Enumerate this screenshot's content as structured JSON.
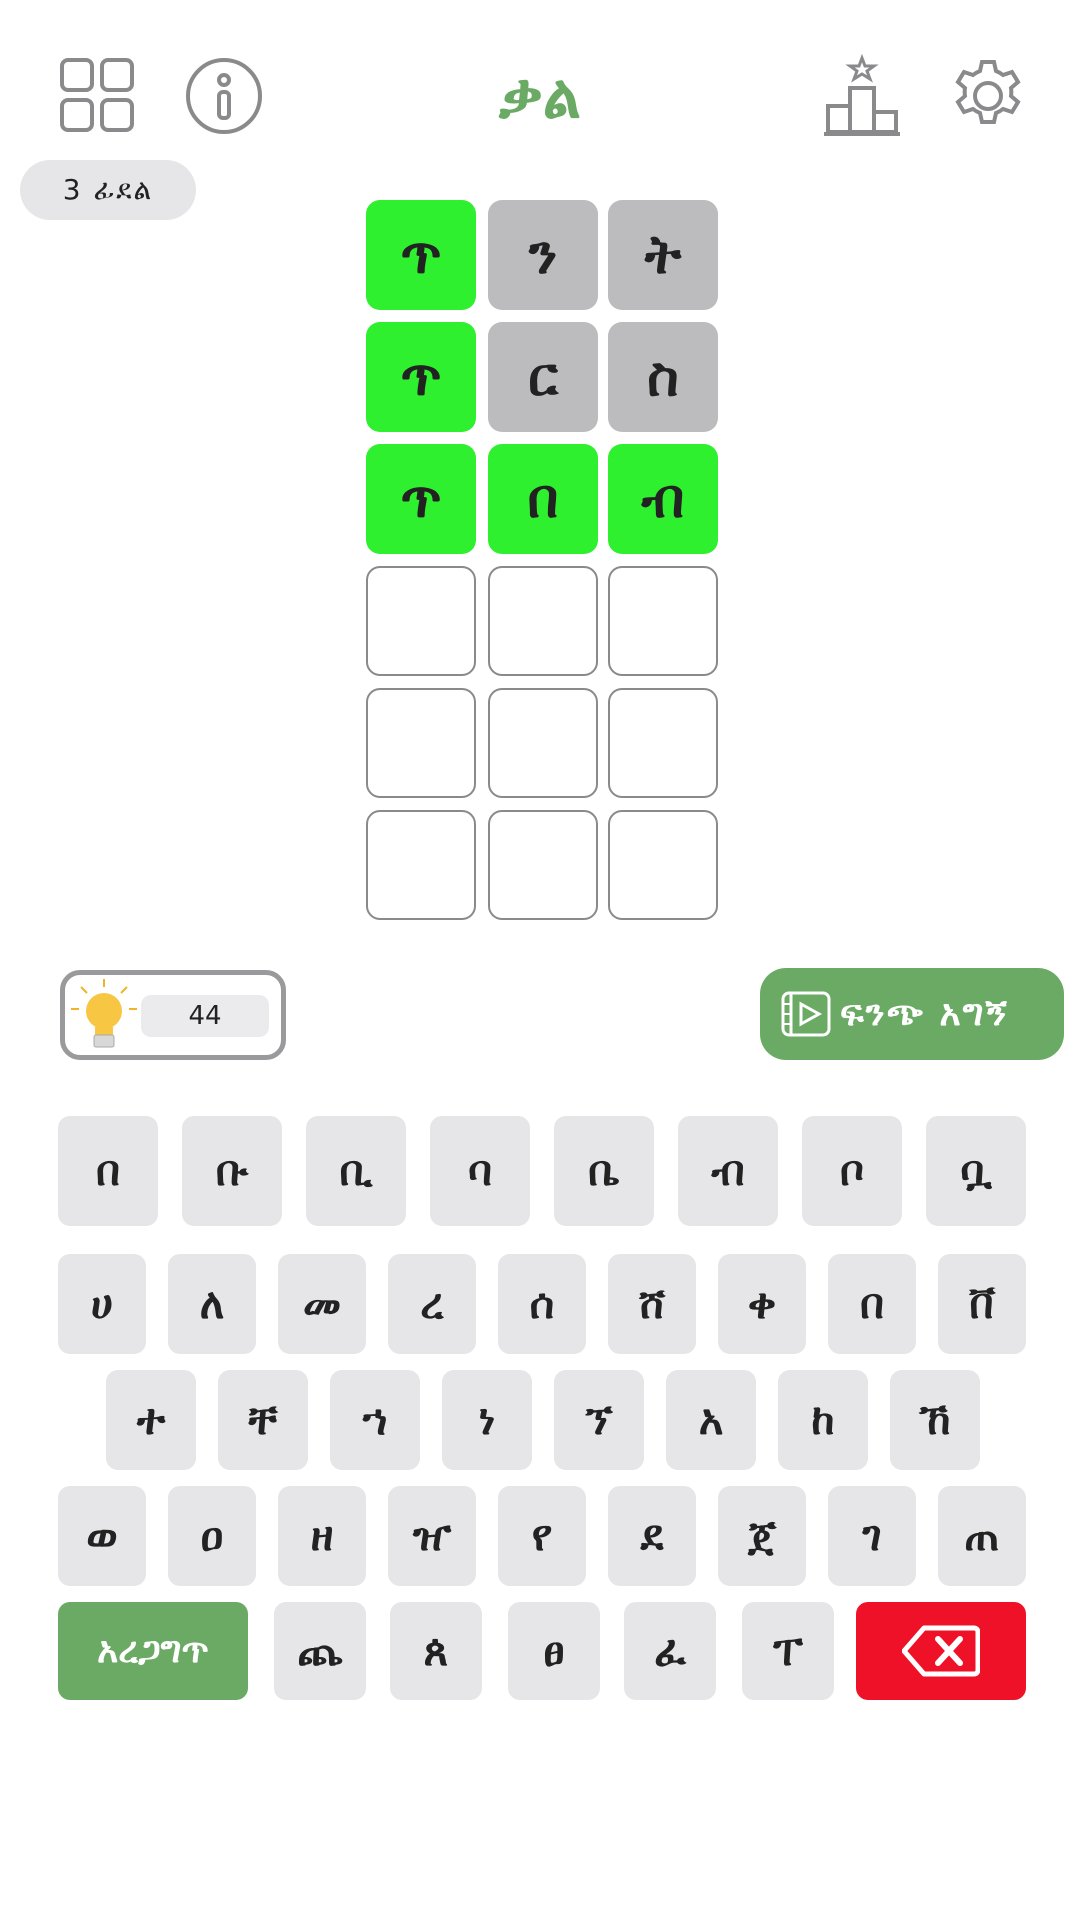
{
  "header": {
    "title": "ቃል",
    "menu_icon": "grid-icon",
    "info_icon": "info-icon",
    "stats_icon": "podium-icon",
    "settings_icon": "gear-icon"
  },
  "badge": {
    "label": "3 ፊደል"
  },
  "board": {
    "rows": [
      [
        {
          "letter": "ጥ",
          "state": "green"
        },
        {
          "letter": "ን",
          "state": "gray"
        },
        {
          "letter": "ት",
          "state": "gray"
        }
      ],
      [
        {
          "letter": "ጥ",
          "state": "green"
        },
        {
          "letter": "ር",
          "state": "gray"
        },
        {
          "letter": "ስ",
          "state": "gray"
        }
      ],
      [
        {
          "letter": "ጥ",
          "state": "green"
        },
        {
          "letter": "በ",
          "state": "green"
        },
        {
          "letter": "ብ",
          "state": "green"
        }
      ],
      [
        {
          "letter": "",
          "state": "empty"
        },
        {
          "letter": "",
          "state": "empty"
        },
        {
          "letter": "",
          "state": "empty"
        }
      ],
      [
        {
          "letter": "",
          "state": "empty"
        },
        {
          "letter": "",
          "state": "empty"
        },
        {
          "letter": "",
          "state": "empty"
        }
      ],
      [
        {
          "letter": "",
          "state": "empty"
        },
        {
          "letter": "",
          "state": "empty"
        },
        {
          "letter": "",
          "state": "empty"
        }
      ]
    ]
  },
  "hints": {
    "count": "44",
    "icon": "lightbulb-icon"
  },
  "reveal": {
    "label": "ፍንጭ አግኝ",
    "icon": "video-icon"
  },
  "keyboard": {
    "row1": [
      "በ",
      "ቡ",
      "ቢ",
      "ባ",
      "ቤ",
      "ብ",
      "ቦ",
      "ቧ"
    ],
    "row2": [
      "ሀ",
      "ለ",
      "መ",
      "ረ",
      "ሰ",
      "ሸ",
      "ቀ",
      "በ",
      "ቨ"
    ],
    "row3": [
      "ተ",
      "ቸ",
      "ኀ",
      "ነ",
      "ኘ",
      "አ",
      "ከ",
      "ኸ"
    ],
    "row4": [
      "ወ",
      "ዐ",
      "ዘ",
      "ዠ",
      "የ",
      "ደ",
      "ጀ",
      "ገ",
      "ጠ"
    ],
    "row5": [
      "ጨ",
      "ጰ",
      "ፀ",
      "ፈ",
      "ፐ"
    ],
    "check_label": "አረጋግጥ",
    "delete_icon": "backspace-icon"
  },
  "colors": {
    "accent": "#6aaa64",
    "correct": "#2ef02e",
    "absent": "#bcbcbe",
    "delete": "#ee1128"
  }
}
